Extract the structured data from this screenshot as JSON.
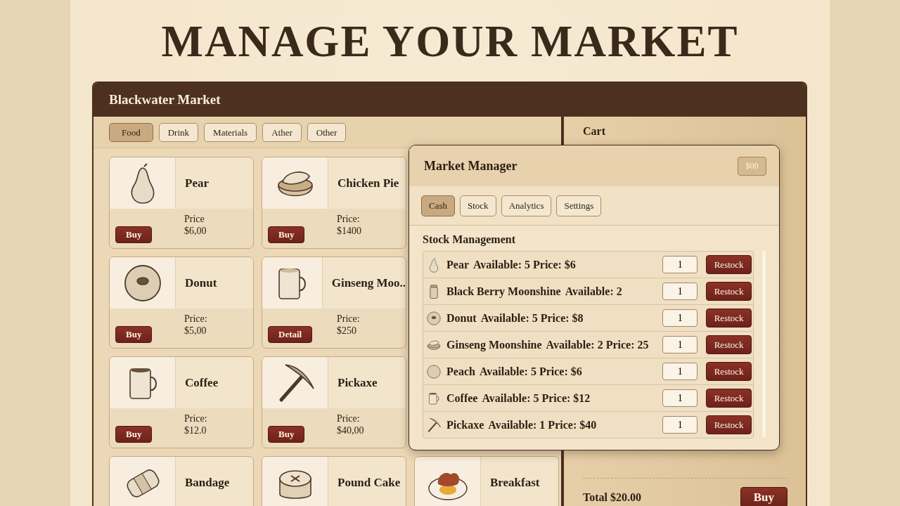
{
  "page_title": "MANAGE YOUR MARKET",
  "window": {
    "title": "Blackwater Market"
  },
  "categories": [
    {
      "label": "Food",
      "selected": true
    },
    {
      "label": "Drink",
      "selected": false
    },
    {
      "label": "Materials",
      "selected": false
    },
    {
      "label": "Ather",
      "selected": false
    },
    {
      "label": "Other",
      "selected": false
    }
  ],
  "product_rows": [
    {
      "cards": [
        {
          "name": "Pear",
          "kind": "pear",
          "price_label": "Price",
          "price": "$6,00",
          "button": "Buy"
        },
        {
          "name": "Chicken Pie",
          "kind": "pie",
          "price_label": "Price:",
          "price": "$1400",
          "button": "Buy"
        }
      ]
    },
    {
      "cards": [
        {
          "name": "Donut",
          "kind": "donut",
          "price_label": "Price:",
          "price": "$5,00",
          "button": "Buy"
        },
        {
          "name": "Ginseng Moo..",
          "kind": "mug",
          "price_label": "Price:",
          "price": "$250",
          "button": "Detail"
        }
      ]
    },
    {
      "cards": [
        {
          "name": "Coffee",
          "kind": "coffee",
          "price_label": "Price:",
          "price": "$12.0",
          "button": "Buy"
        },
        {
          "name": "Pickaxe",
          "kind": "pickaxe",
          "price_label": "Price:",
          "price": "$40,00",
          "button": "Buy"
        }
      ]
    },
    {
      "cards": [
        {
          "name": "Bandage",
          "kind": "bandage"
        },
        {
          "name": "Pound Cake",
          "kind": "cake"
        },
        {
          "name": "Breakfast",
          "kind": "breakfast"
        }
      ]
    }
  ],
  "cart": {
    "title": "Cart",
    "total": "Total $20.00",
    "button": "Buy"
  },
  "manager": {
    "title": "Market Manager",
    "balance": "$00",
    "tabs": [
      {
        "label": "Cash",
        "selected": true
      },
      {
        "label": "Stock",
        "selected": false
      },
      {
        "label": "Analytics",
        "selected": false
      },
      {
        "label": "Settings",
        "selected": false
      }
    ],
    "section_title": "Stock Management",
    "stock": [
      {
        "kind": "pear",
        "name": "Pear",
        "info": "Available: 5 Price: $6",
        "quantity": "1",
        "button": "Restock"
      },
      {
        "kind": "jar",
        "name": "Black Berry Moonshine",
        "info": "Available: 2",
        "quantity": "1",
        "button": "Restock"
      },
      {
        "kind": "donut",
        "name": "Donut",
        "info": "Available: 5 Price: $8",
        "quantity": "1",
        "button": "Restock"
      },
      {
        "kind": "pie",
        "name": "Ginseng Moonshine",
        "info": "Available: 2 Price: 25",
        "quantity": "1",
        "button": "Restock"
      },
      {
        "kind": "peach",
        "name": "Peach",
        "info": "Available: 5 Price: $6",
        "quantity": "1",
        "button": "Restock"
      },
      {
        "kind": "coffee",
        "name": "Coffee",
        "info": "Available: 5 Price: $12",
        "quantity": "1",
        "button": "Restock"
      },
      {
        "kind": "pickaxe",
        "name": "Pickaxe",
        "info": "Available: 1 Price: $40",
        "quantity": "1",
        "button": "Restock"
      }
    ]
  }
}
